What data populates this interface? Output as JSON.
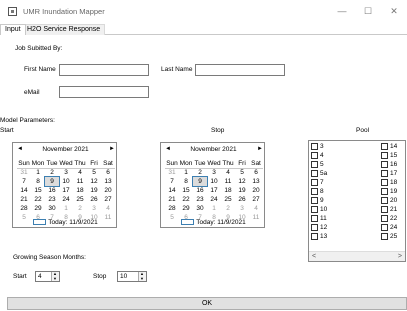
{
  "window": {
    "title": "UMR Inundation Mapper",
    "controls": {
      "minimize": "—",
      "maximize": "☐",
      "close": "✕"
    }
  },
  "tabs": [
    {
      "label": "Input",
      "active": true
    },
    {
      "label": "H2O Service Response",
      "active": false
    }
  ],
  "job": {
    "heading": "Job Subitted By:",
    "first_name_label": "First Name",
    "first_name_value": "",
    "last_name_label": "Last Name",
    "last_name_value": "",
    "email_label": "eMail",
    "email_value": ""
  },
  "model": {
    "heading": "Model Parameters:",
    "start_label": "Start",
    "stop_label": "Stop",
    "pool_label": "Pool"
  },
  "calendars": {
    "month_title": "November 2021",
    "day_headers": [
      "Sun",
      "Mon",
      "Tue",
      "Wed",
      "Thu",
      "Fri",
      "Sat"
    ],
    "weeks": [
      [
        "31",
        "1",
        "2",
        "3",
        "4",
        "5",
        "6"
      ],
      [
        "7",
        "8",
        "9",
        "10",
        "11",
        "12",
        "13"
      ],
      [
        "14",
        "15",
        "16",
        "17",
        "18",
        "19",
        "20"
      ],
      [
        "21",
        "22",
        "23",
        "24",
        "25",
        "26",
        "27"
      ],
      [
        "28",
        "29",
        "30",
        "1",
        "2",
        "3",
        "4"
      ],
      [
        "5",
        "6",
        "7",
        "8",
        "9",
        "10",
        "11"
      ]
    ],
    "today_label": "Today: 11/9/2021",
    "prev_arrow": "◄",
    "next_arrow": "►"
  },
  "pool": {
    "col1": [
      "3",
      "4",
      "5",
      "5a",
      "7",
      "8",
      "9",
      "10",
      "11",
      "12",
      "13"
    ],
    "col2": [
      "14",
      "15",
      "16",
      "17",
      "18",
      "19",
      "20",
      "21",
      "22",
      "24",
      "25"
    ],
    "scroll_left": "<",
    "scroll_right": ">"
  },
  "season": {
    "heading": "Growing Season Months:",
    "start_label": "Start",
    "start_value": "4",
    "stop_label": "Stop",
    "stop_value": "10"
  },
  "ok_label": "OK"
}
